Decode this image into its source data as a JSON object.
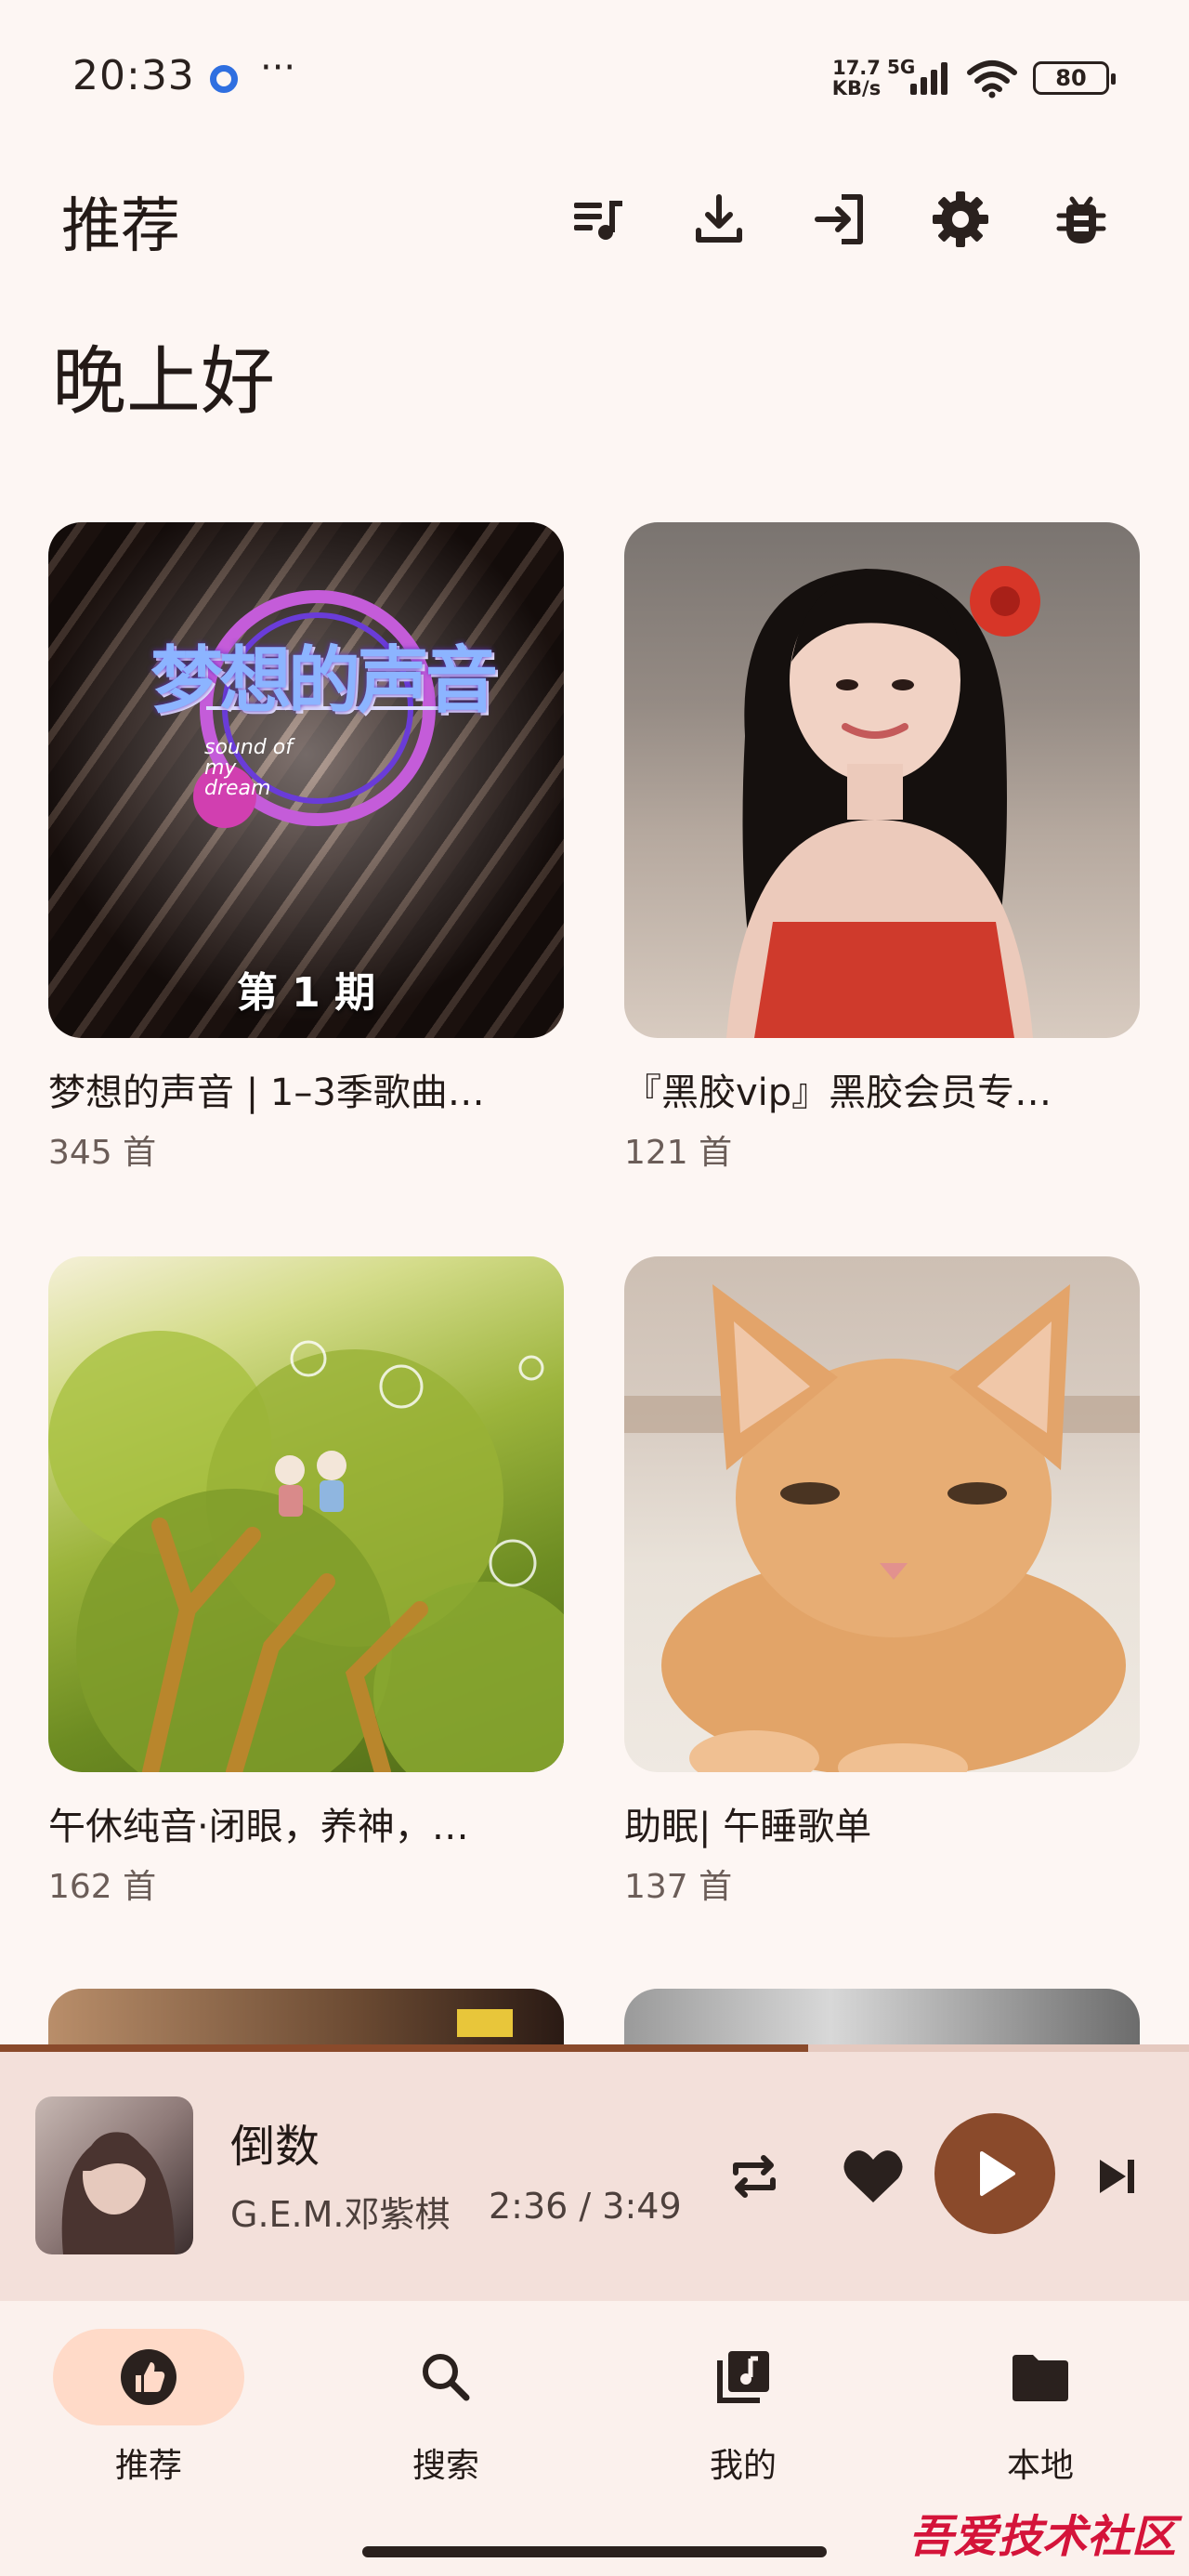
{
  "status_bar": {
    "time": "20:33",
    "more": "···",
    "speed_value": "17.7",
    "speed_unit": "KB/s",
    "network": "5G",
    "battery": "80"
  },
  "header": {
    "title": "推荐",
    "actions": [
      "playlist-icon",
      "download-icon",
      "login-icon",
      "settings-icon",
      "bug-icon"
    ]
  },
  "greeting": "晚上好",
  "playlists": [
    {
      "title": "梦想的声音 | 1–3季歌曲…",
      "count": "345 首",
      "cover_text_top": "梦想的声音",
      "cover_text_sub": "sound of my dream",
      "cover_text_bottom": "第 1 期"
    },
    {
      "title": "『黑胶vip』黑胶会员专…",
      "count": "121 首"
    },
    {
      "title": "午休纯音·闭眼，养神，…",
      "count": "162 首"
    },
    {
      "title": "助眠| 午睡歌单",
      "count": "137 首"
    }
  ],
  "player": {
    "title": "倒数",
    "artist": "G.E.M.邓紫棋",
    "time": "2:36 / 3:49",
    "progress": 0.68
  },
  "nav": {
    "items": [
      {
        "label": "推荐",
        "icon": "thumb-up-icon",
        "active": true
      },
      {
        "label": "搜索",
        "icon": "search-icon",
        "active": false
      },
      {
        "label": "我的",
        "icon": "library-music-icon",
        "active": false
      },
      {
        "label": "本地",
        "icon": "folder-icon",
        "active": false
      }
    ]
  },
  "watermark": "吾爱技术社区"
}
